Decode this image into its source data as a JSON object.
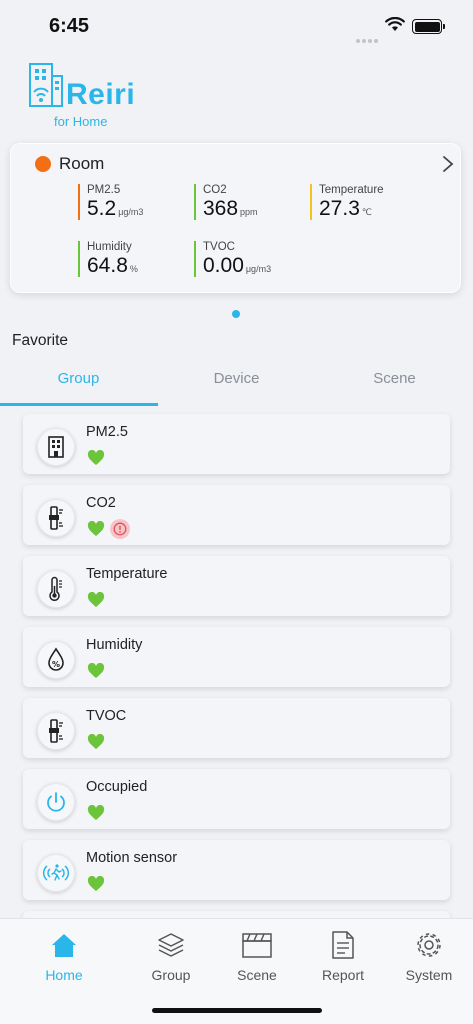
{
  "status_bar": {
    "time": "6:45"
  },
  "logo": {
    "word": "Reiri",
    "subtitle": "for Home"
  },
  "room_card": {
    "name": "Room",
    "status_color": "#f46f14",
    "metrics": [
      {
        "label": "PM2.5",
        "value": "5.2",
        "unit": "μg/m3",
        "color": "#f46f14"
      },
      {
        "label": "CO2",
        "value": "368",
        "unit": "ppm",
        "color": "#6cc43a"
      },
      {
        "label": "Temperature",
        "value": "27.3",
        "unit": "℃",
        "color": "#f3c21b"
      },
      {
        "label": "Humidity",
        "value": "64.8",
        "unit": "%",
        "color": "#6cc43a"
      },
      {
        "label": "TVOC",
        "value": "0.00",
        "unit": "μg/m3",
        "color": "#6cc43a"
      }
    ]
  },
  "favorite": {
    "title": "Favorite",
    "tabs": [
      {
        "label": "Group",
        "active": true
      },
      {
        "label": "Device",
        "active": false
      },
      {
        "label": "Scene",
        "active": false
      }
    ]
  },
  "group_items": [
    {
      "label": "PM2.5",
      "icon": "building-icon",
      "alert": false
    },
    {
      "label": "CO2",
      "icon": "sensor-icon",
      "alert": true
    },
    {
      "label": "Temperature",
      "icon": "thermometer-icon",
      "alert": false
    },
    {
      "label": "Humidity",
      "icon": "humidity-drop-icon",
      "alert": false
    },
    {
      "label": "TVOC",
      "icon": "sensor-icon",
      "alert": false
    },
    {
      "label": "Occupied",
      "icon": "power-icon",
      "alert": false
    },
    {
      "label": "Motion sensor",
      "icon": "motion-sensor-icon",
      "alert": false
    }
  ],
  "bottom_nav": [
    {
      "label": "Home",
      "icon": "home-icon",
      "active": true
    },
    {
      "label": "Group",
      "icon": "layers-icon",
      "active": false
    },
    {
      "label": "Scene",
      "icon": "clapperboard-icon",
      "active": false
    },
    {
      "label": "Report",
      "icon": "report-icon",
      "active": false
    },
    {
      "label": "System",
      "icon": "gear-icon",
      "active": false
    }
  ],
  "colors": {
    "accent": "#2bb6ea",
    "good": "#6cc43a",
    "alert": "#e0535f"
  }
}
